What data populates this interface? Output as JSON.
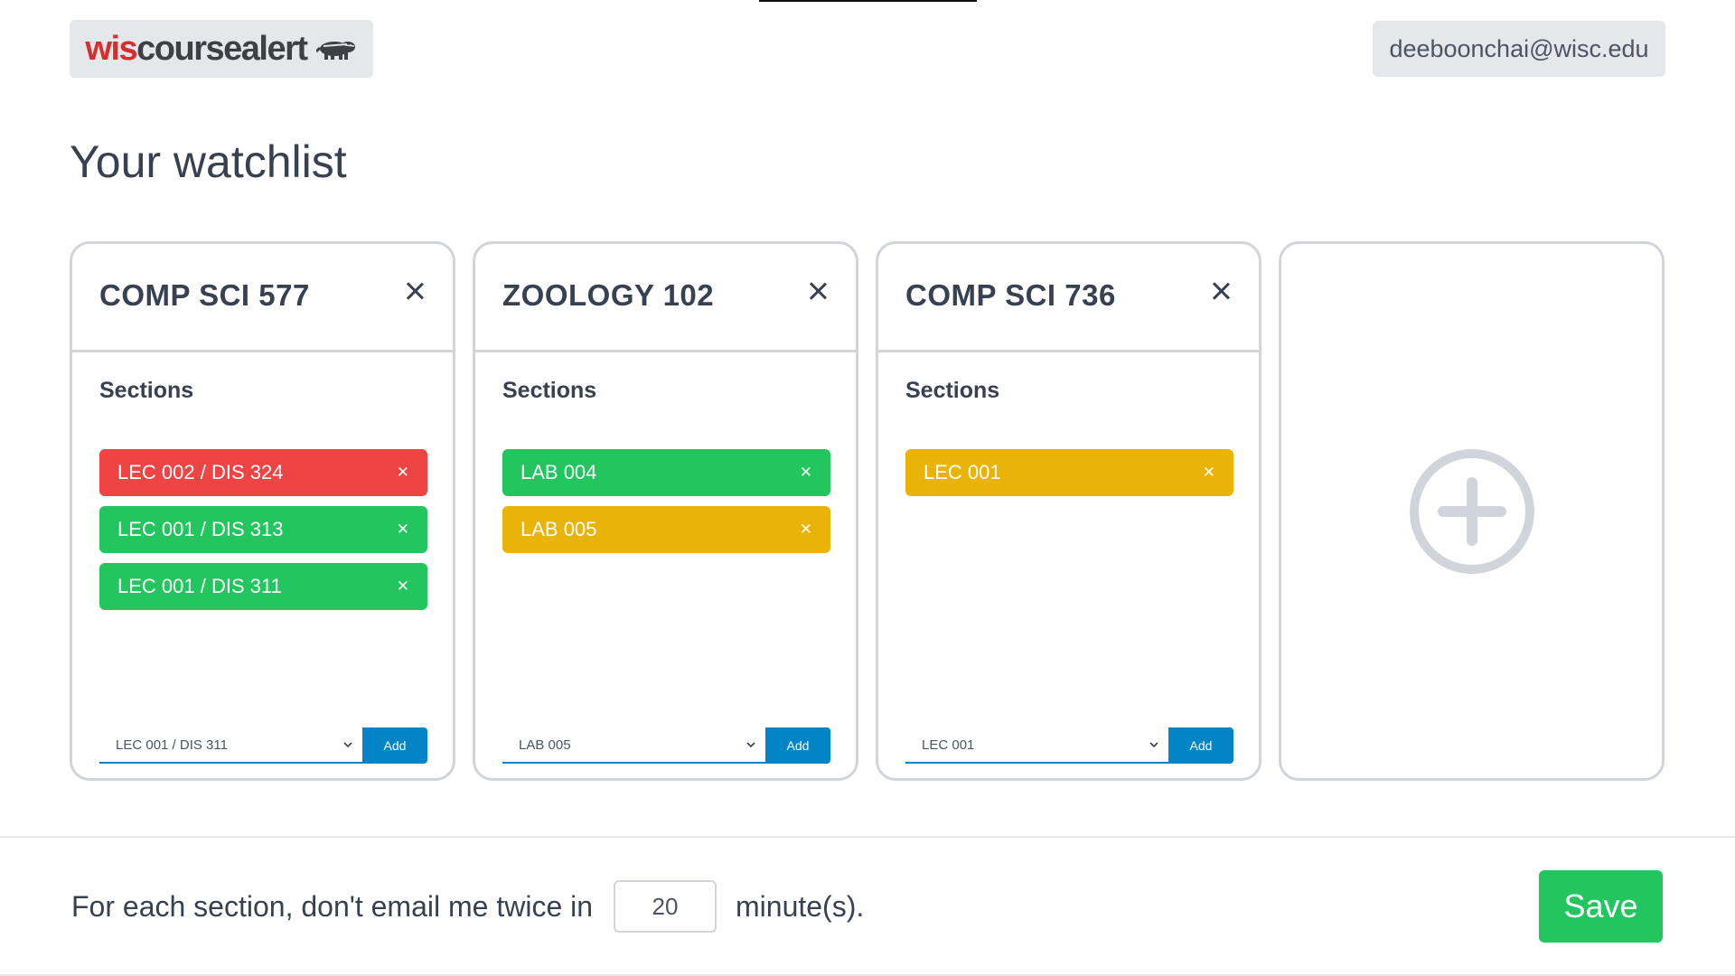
{
  "header": {
    "logo_part1": "wis",
    "logo_part2": "coursealert",
    "user_email": "deeboonchai@wisc.edu"
  },
  "main": {
    "title": "Your watchlist",
    "sections_label": "Sections",
    "add_label": "Add",
    "courses": [
      {
        "title": "COMP SCI 577",
        "sections": [
          {
            "label": "LEC 002 / DIS 324",
            "status": "red"
          },
          {
            "label": "LEC 001 / DIS 313",
            "status": "green"
          },
          {
            "label": "LEC 001 / DIS 311",
            "status": "green"
          }
        ],
        "selected_option": "LEC 001 / DIS 311"
      },
      {
        "title": "ZOOLOGY 102",
        "sections": [
          {
            "label": "LAB 004",
            "status": "green"
          },
          {
            "label": "LAB 005",
            "status": "yellow"
          }
        ],
        "selected_option": "LAB 005"
      },
      {
        "title": "COMP SCI 736",
        "sections": [
          {
            "label": "LEC 001",
            "status": "yellow"
          }
        ],
        "selected_option": "LEC 001"
      }
    ]
  },
  "footer": {
    "text_before": "For each section, don't email me twice in",
    "minutes_value": "20",
    "text_after": "minute(s).",
    "save_label": "Save"
  },
  "colors": {
    "red": "#ef4444",
    "green": "#22c55e",
    "yellow": "#eab308",
    "accent_blue": "#0284c7"
  },
  "icons": {
    "remove": "close-icon",
    "add_course": "plus-circle-icon",
    "dropdown": "chevron-down-icon",
    "logo": "badger-icon"
  }
}
